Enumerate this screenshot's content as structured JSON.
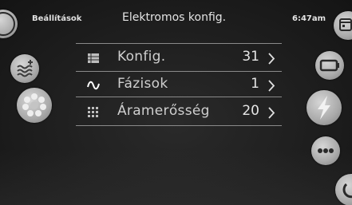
{
  "header": {
    "back_label": "Beállítások",
    "title": "Elektromos konfig.",
    "time": "6:47am"
  },
  "settings_rows": [
    {
      "icon": "grid-table-icon",
      "label": "Konfig.",
      "value": "31"
    },
    {
      "icon": "sine-wave-icon",
      "label": "Fázisok",
      "value": "1"
    },
    {
      "icon": "grid-dots-icon",
      "label": "Áramerősség",
      "value": "20"
    }
  ],
  "left_nav": [
    {
      "icon": "water-heat-icon"
    },
    {
      "icon": "light-ring-icon"
    }
  ],
  "right_nav": [
    {
      "icon": "calendar-icon"
    },
    {
      "icon": "battery-icon"
    },
    {
      "icon": "lightning-icon"
    },
    {
      "icon": "more-dots-icon"
    },
    {
      "icon": "power-icon"
    }
  ],
  "colors": {
    "background": "#1e1e1e",
    "button": "#b0b0b0",
    "text": "#d8d8d8"
  }
}
